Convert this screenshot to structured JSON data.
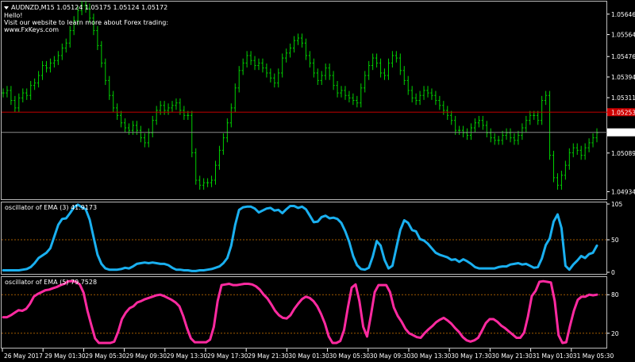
{
  "chart": {
    "symbol_line": "AUDNZD,M15  1.05124 1.05175 1.05124 1.05172",
    "comment_lines": [
      "Hello!",
      "Visit our website to learn more about Forex trading:",
      "www.FxKeys.com"
    ],
    "bid_price": "1.05172",
    "red_level_price": "1.05253",
    "colors": {
      "background": "#000000",
      "candles": "#00d000",
      "red_line": "#c00000",
      "bid_line": "#8a8a8a",
      "ema3": "#1ab0f0",
      "ema5": "#ff2aa0",
      "level": "#a05a00",
      "axis": "#ffffff"
    }
  },
  "x_labels": [
    "26 May 2017",
    "29 May 01:30",
    "29 May 05:30",
    "29 May 09:30",
    "29 May 13:30",
    "29 May 17:30",
    "29 May 21:30",
    "30 May 01:30",
    "30 May 05:30",
    "30 May 09:30",
    "30 May 13:30",
    "30 May 17:30",
    "30 May 21:30",
    "31 May 01:30",
    "31 May 05:30"
  ],
  "chart_data": [
    {
      "type": "ohlc",
      "panel": "price",
      "y_ticks": [
        "1.05646",
        "1.05564",
        "1.05476",
        "1.05394",
        "1.05311",
        "1.05253",
        "1.05172",
        "1.05089",
        "1.04934"
      ],
      "ylim": [
        1.0491,
        1.0569
      ],
      "levels": [
        1.05253,
        1.05172
      ],
      "series": [
        {
          "name": "AUDNZD,M15",
          "values": [
            1.0533,
            1.0534,
            1.053,
            1.0527,
            1.0531,
            1.0533,
            1.0532,
            1.0536,
            1.0537,
            1.054,
            1.0544,
            1.0543,
            1.0545,
            1.0546,
            1.0548,
            1.0551,
            1.0553,
            1.0558,
            1.0562,
            1.0566,
            1.0568,
            1.0567,
            1.0563,
            1.0558,
            1.0552,
            1.0545,
            1.0538,
            1.0532,
            1.0527,
            1.0524,
            1.0521,
            1.0519,
            1.0518,
            1.052,
            1.0518,
            1.0515,
            1.0513,
            1.0517,
            1.0522,
            1.0526,
            1.0528,
            1.0526,
            1.0527,
            1.0528,
            1.0529,
            1.0526,
            1.0524,
            1.0524,
            1.0509,
            1.0498,
            1.0496,
            1.0497,
            1.0497,
            1.0498,
            1.0504,
            1.051,
            1.0515,
            1.0521,
            1.0527,
            1.0535,
            1.0542,
            1.0545,
            1.0548,
            1.0546,
            1.0544,
            1.0545,
            1.0543,
            1.0541,
            1.0539,
            1.0537,
            1.0541,
            1.0547,
            1.0549,
            1.0551,
            1.0554,
            1.0555,
            1.0553,
            1.0548,
            1.0545,
            1.0541,
            1.0538,
            1.054,
            1.0543,
            1.054,
            1.0536,
            1.0533,
            1.0534,
            1.0532,
            1.0531,
            1.053,
            1.0529,
            1.0535,
            1.054,
            1.0544,
            1.0547,
            1.0545,
            1.0541,
            1.054,
            1.0545,
            1.0548,
            1.0547,
            1.0542,
            1.0538,
            1.0534,
            1.0531,
            1.053,
            1.0532,
            1.0534,
            1.0533,
            1.0532,
            1.053,
            1.0528,
            1.0526,
            1.0524,
            1.0522,
            1.0518,
            1.0518,
            1.0517,
            1.0516,
            1.0519,
            1.0521,
            1.0522,
            1.052,
            1.0517,
            1.0515,
            1.0514,
            1.0514,
            1.0516,
            1.0517,
            1.0515,
            1.0514,
            1.0516,
            1.0519,
            1.0522,
            1.0524,
            1.0524,
            1.0522,
            1.053,
            1.0532,
            1.0508,
            1.0499,
            1.0496,
            1.05,
            1.0504,
            1.0509,
            1.0511,
            1.051,
            1.0508,
            1.0511,
            1.0513,
            1.0515,
            1.0517
          ]
        }
      ]
    },
    {
      "type": "line",
      "panel": "oscillator-1",
      "title": "oscillator of EMA (3) 41.9173",
      "ylim": [
        0,
        105
      ],
      "y_ticks": [
        "105",
        "50",
        "0"
      ],
      "levels": [
        50
      ],
      "series": [
        {
          "name": "oscillator of EMA (3)",
          "values": [
            3,
            3,
            3,
            3,
            3,
            4,
            5,
            8,
            14,
            22,
            26,
            30,
            37,
            55,
            73,
            82,
            83,
            91,
            100,
            104,
            100,
            97,
            81,
            54,
            27,
            13,
            6,
            4,
            4,
            4,
            5,
            7,
            6,
            9,
            13,
            14,
            15,
            14,
            15,
            14,
            13,
            13,
            11,
            7,
            4,
            4,
            3,
            3,
            2,
            2,
            3,
            3,
            4,
            5,
            7,
            9,
            14,
            22,
            41,
            73,
            96,
            100,
            101,
            101,
            98,
            92,
            95,
            98,
            99,
            95,
            96,
            91,
            97,
            102,
            102,
            99,
            101,
            97,
            87,
            77,
            78,
            85,
            87,
            83,
            84,
            82,
            76,
            63,
            47,
            25,
            11,
            5,
            4,
            7,
            24,
            48,
            41,
            19,
            6,
            10,
            38,
            65,
            80,
            76,
            65,
            63,
            51,
            49,
            44,
            37,
            30,
            27,
            25,
            23,
            19,
            20,
            16,
            20,
            17,
            13,
            8,
            6,
            6,
            6,
            6,
            6,
            8,
            9,
            9,
            12,
            13,
            14,
            12,
            13,
            10,
            7,
            8,
            21,
            42,
            52,
            78,
            89,
            68,
            10,
            4,
            12,
            18,
            25,
            22,
            28,
            30,
            41
          ]
        }
      ]
    },
    {
      "type": "line",
      "panel": "oscillator-2",
      "title": "oscillator of EMA (5) 79.7528",
      "ylim": [
        0,
        105
      ],
      "y_ticks": [
        "80",
        "20"
      ],
      "levels": [
        80,
        20
      ],
      "series": [
        {
          "name": "oscillator of EMA (5)",
          "values": [
            45,
            45,
            48,
            52,
            56,
            55,
            58,
            66,
            77,
            81,
            84,
            87,
            88,
            90,
            92,
            95,
            97,
            101,
            101,
            100,
            96,
            83,
            55,
            33,
            12,
            5,
            5,
            5,
            5,
            7,
            22,
            42,
            52,
            59,
            62,
            68,
            70,
            73,
            75,
            77,
            79,
            80,
            78,
            75,
            72,
            68,
            62,
            47,
            28,
            12,
            6,
            6,
            6,
            6,
            10,
            30,
            70,
            95,
            96,
            97,
            95,
            95,
            96,
            97,
            97,
            96,
            93,
            88,
            80,
            74,
            65,
            55,
            48,
            44,
            43,
            48,
            58,
            66,
            73,
            77,
            75,
            70,
            62,
            50,
            35,
            15,
            5,
            5,
            8,
            25,
            60,
            91,
            96,
            70,
            30,
            15,
            48,
            84,
            95,
            95,
            95,
            84,
            60,
            47,
            38,
            27,
            20,
            17,
            14,
            13,
            20,
            26,
            31,
            37,
            41,
            44,
            40,
            35,
            28,
            22,
            14,
            9,
            7,
            9,
            13,
            24,
            36,
            42,
            42,
            38,
            32,
            28,
            23,
            18,
            13,
            13,
            21,
            46,
            78,
            86,
            100,
            101,
            100,
            99,
            70,
            17,
            5,
            6,
            32,
            55,
            72,
            77,
            77,
            80,
            79,
            80
          ]
        }
      ]
    }
  ]
}
